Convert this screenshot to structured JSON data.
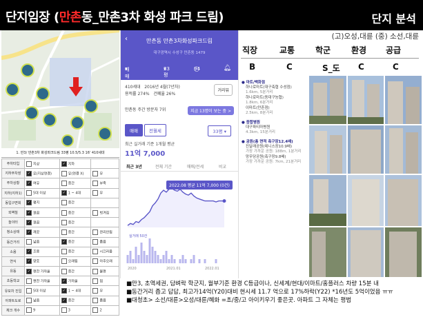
{
  "title": {
    "prefix": "단지임장 (",
    "highlight": "만촌",
    "suffix": "동_만촌3차 화성 파크 드림)"
  },
  "section_title": "단지 분석",
  "subtitle": "(고)오성,대륜 (중) 소선,대륜",
  "map_caption": "1. 만3/ 만촌3차 화성파크드림 33평 10.5/5.3 16' 410세대",
  "checklist": [
    {
      "label": "주차타입",
      "options": [
        {
          "t": "지상",
          "on": false
        },
        {
          "t": "지하",
          "on": true
        }
      ]
    },
    {
      "label": "지하주차장",
      "options": [
        {
          "t": "유(지상연결)",
          "on": true
        },
        {
          "t": "유(연결 X)",
          "on": false
        },
        {
          "t": "무",
          "on": false
        }
      ]
    },
    {
      "label": "주차상황",
      "options": [
        {
          "t": "여유",
          "on": true
        },
        {
          "t": "중간",
          "on": false
        },
        {
          "t": "부족",
          "on": false
        }
      ]
    },
    {
      "label": "지하(지하1)",
      "options": [
        {
          "t": "5대 이상",
          "on": false
        },
        {
          "t": "1 ~ 4대",
          "on": true
        },
        {
          "t": "무",
          "on": false
        }
      ]
    },
    {
      "label": "동입구면희",
      "options": [
        {
          "t": "평지",
          "on": true
        },
        {
          "t": "중간",
          "on": false
        }
      ]
    },
    {
      "label": "외벽칠",
      "options": [
        {
          "t": "깔끔",
          "on": true
        },
        {
          "t": "중간",
          "on": false
        },
        {
          "t": "벗겨짐",
          "on": false
        }
      ]
    },
    {
      "label": "놀이터",
      "options": [
        {
          "t": "깔끔",
          "on": true
        },
        {
          "t": "중간",
          "on": false
        }
      ]
    },
    {
      "label": "청소상태",
      "options": [
        {
          "t": "깨끗",
          "on": true
        },
        {
          "t": "중간",
          "on": false
        },
        {
          "t": "관리안됨",
          "on": false
        }
      ]
    },
    {
      "label": "동간거리",
      "options": [
        {
          "t": "넓음",
          "on": false
        },
        {
          "t": "중간",
          "on": true
        },
        {
          "t": "좁음",
          "on": false
        }
      ]
    },
    {
      "label": "소음",
      "options": [
        {
          "t": "조용",
          "on": true
        },
        {
          "t": "중간",
          "on": false
        },
        {
          "t": "시끄러움",
          "on": false
        }
      ]
    },
    {
      "label": "연식",
      "options": [
        {
          "t": "양호",
          "on": true
        },
        {
          "t": "오래됨",
          "on": false
        },
        {
          "t": "아주오래",
          "on": false
        }
      ]
    },
    {
      "label": "유동",
      "options": [
        {
          "t": "편한 가까울",
          "on": true
        },
        {
          "t": "중간",
          "on": false
        },
        {
          "t": "불편",
          "on": false
        }
      ]
    },
    {
      "label": "초등학교",
      "options": [
        {
          "t": "편한 가까울",
          "on": false
        },
        {
          "t": "가까울",
          "on": true
        },
        {
          "t": "멈",
          "on": false
        }
      ]
    },
    {
      "label": "유모차 진입",
      "options": [
        {
          "t": "5대 이상",
          "on": false
        },
        {
          "t": "1 ~ 4대",
          "on": true
        },
        {
          "t": "무",
          "on": false
        }
      ]
    },
    {
      "label": "아파트도로",
      "options": [
        {
          "t": "넓음",
          "on": false
        },
        {
          "t": "중간",
          "on": true
        },
        {
          "t": "좁음",
          "on": false
        }
      ]
    },
    {
      "label": "체크 개수",
      "options": [
        {
          "t": "9",
          "on": false
        },
        {
          "t": "3",
          "on": false
        },
        {
          "t": "2",
          "on": false
        }
      ]
    }
  ],
  "phone": {
    "title": "만촌동 만촌3차화성파크드림",
    "address": "대구광역시 수성구 만촌동 1479",
    "trade": "매매",
    "pyeong": "33평",
    "views": "94",
    "households": "410세대",
    "built": "2016년 4월(7년차)",
    "floor_area_ratio": "용적률 274%",
    "coverage": "건폐율 26%",
    "distance_btn": "거리뷰",
    "visit_rank": "만촌동 주간 방문자 7위",
    "visit_link": "지금 13명이 보는 중 >",
    "tab_sale": "매매",
    "tab_rent": "전월세",
    "size_select": "33평",
    "price_label": "최근 실거래 기준 1개월 평균",
    "price": "11억 7,000",
    "periods": [
      "최근 3년",
      "전체 기간",
      "매매/전세",
      "비교"
    ],
    "tooltip": "2022.08 평균 11억 7,000 (0건)"
  },
  "chart_data": {
    "type": "line",
    "x": [
      0,
      1,
      2,
      3,
      4,
      5,
      6,
      7,
      8,
      9,
      10,
      11,
      12,
      13,
      14,
      15,
      16,
      17,
      18,
      19,
      20,
      21,
      22,
      23,
      24,
      25,
      26,
      27,
      28,
      29,
      30,
      31,
      32,
      33,
      34,
      35
    ],
    "values": [
      9.2,
      9.4,
      9.3,
      9.6,
      9.5,
      9.8,
      10.0,
      10.3,
      10.6,
      11.2,
      11.5,
      11.9,
      12.5,
      12.8,
      12.6,
      12.9,
      13.0,
      12.8,
      12.7,
      12.9,
      12.6,
      12.4,
      12.3,
      12.5,
      12.2,
      12.0,
      11.9,
      11.8,
      11.7,
      11.7,
      11.7,
      11.7,
      11.6,
      11.7,
      11.7,
      11.7
    ],
    "tick_labels": [
      "2020",
      "2021.01",
      "2022.01"
    ],
    "volume": [
      2,
      3,
      1,
      4,
      2,
      5,
      3,
      2,
      6,
      4,
      3,
      2,
      1,
      2,
      3,
      1,
      2,
      1,
      0,
      1,
      2,
      1,
      0,
      1,
      2,
      0,
      1,
      0,
      1,
      0,
      0,
      0,
      1,
      0,
      0,
      0
    ],
    "legend": "실거래 50건"
  },
  "criteria": {
    "headers": [
      "직장",
      "교통",
      "학군",
      "환경",
      "공급"
    ],
    "values": [
      "B",
      "C",
      "S_도",
      "C",
      "C"
    ]
  },
  "amenities": [
    {
      "cat": "마트/백화점",
      "items": [
        {
          "name": "하나로마트(대구축협 수성점)",
          "dist": "1.6km, 5분거리"
        },
        {
          "name": "하나로마트(동대구농협)",
          "name2": "이마트(만촌점)",
          "dist": "1.8km, 6분거리",
          "dist2": "2.5km, 8분거리"
        }
      ]
    },
    {
      "cat": "종합병원",
      "items": [
        {
          "name": "대구파티마병원",
          "dist": "4.3km, 15분거리"
        }
      ]
    },
    {
      "cat": "공원(총 면적 축구장12.4배)",
      "items": [
        {
          "name": "진달래공원(테니스장10.9배)",
          "dist": "가장 가까운 공원: 188m, 1분거리"
        },
        {
          "name": "망우당공원(축구장9.8배)",
          "dist": "가장 가까운 공원: 7km, 21분거리"
        }
      ]
    }
  ],
  "notes": [
    "■만3, 초역세권, 담벼락 학군지, 월부기준 환경 C등급이나, 신세계/현대/이마트/홈플러스 차량 15분 내",
    "■동간거리 좁고 답답, 최고가14억(Y20)대비 현시세 11.7 억으로 17%하락(Y22) *16년도 5억이었음 ㅠㅠ",
    "■대청초> 소선/대륜>오성/대륜/혜화 =초/중/고 아이키우기 좋은곳. 아파트 그 자체는 평범"
  ],
  "colors": {
    "accent": "#5a56c8",
    "title_highlight": "#ff2a2a",
    "title_bg": "#000000"
  }
}
